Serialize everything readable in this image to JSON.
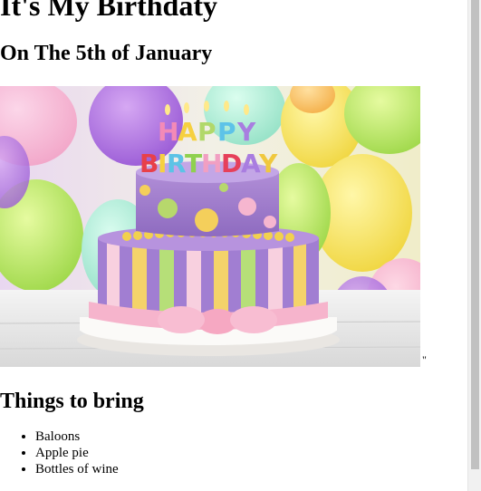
{
  "page": {
    "title": "It's My Birthdaty",
    "subtitle": "On The 5th of January",
    "image_alt": "Happy Birthday cake",
    "cake_topper": {
      "line1": "HAPPY",
      "line2": "BIRTHDAY"
    },
    "stray_text": "\"",
    "list_heading": "Things to bring",
    "items": [
      "Baloons",
      "Apple pie",
      "Bottles of wine"
    ]
  },
  "colors": {
    "background": "#ffffff",
    "text": "#000000",
    "scrollbar_track": "#f1f1f1",
    "scrollbar_thumb": "#c1c1c1"
  }
}
